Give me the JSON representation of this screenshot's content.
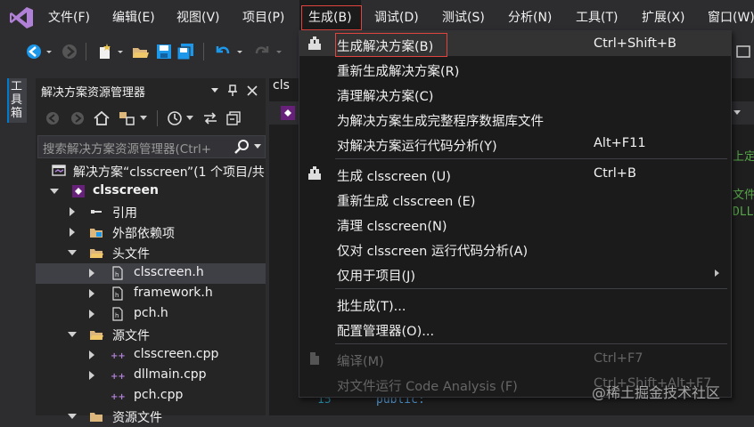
{
  "menubar": {
    "items": [
      {
        "label": "文件(F)"
      },
      {
        "label": "编辑(E)"
      },
      {
        "label": "视图(V)"
      },
      {
        "label": "项目(P)"
      },
      {
        "label": "生成(B)"
      },
      {
        "label": "调试(D)"
      },
      {
        "label": "测试(S)"
      },
      {
        "label": "分析(N)"
      },
      {
        "label": "工具(T)"
      },
      {
        "label": "扩展(X)"
      },
      {
        "label": "窗口(W)"
      }
    ]
  },
  "toolbox": {
    "label": "工具箱"
  },
  "solution_explorer": {
    "title": "解决方案资源管理器",
    "search_placeholder": "搜索解决方案资源管理器(Ctrl+",
    "tree": [
      {
        "label": "解决方案“clsscreen”(1 个项目/共",
        "icon": "solution-icon"
      },
      {
        "label": "clsscreen",
        "icon": "project-icon"
      },
      {
        "label": "引用",
        "icon": "references-icon"
      },
      {
        "label": "外部依赖项",
        "icon": "external-deps-icon"
      },
      {
        "label": "头文件",
        "icon": "folder-icon"
      },
      {
        "label": "clsscreen.h",
        "icon": "header-file-icon"
      },
      {
        "label": "framework.h",
        "icon": "header-file-icon"
      },
      {
        "label": "pch.h",
        "icon": "header-file-icon"
      },
      {
        "label": "源文件",
        "icon": "folder-icon"
      },
      {
        "label": "clsscreen.cpp",
        "icon": "cpp-file-icon"
      },
      {
        "label": "dllmain.cpp",
        "icon": "cpp-file-icon"
      },
      {
        "label": "pch.cpp",
        "icon": "cpp-file-icon"
      },
      {
        "label": "资源文件",
        "icon": "folder-icon"
      }
    ]
  },
  "editor": {
    "tab_label": "cls",
    "line_number": "15",
    "code_line": "public:",
    "side_text": [
      "上定",
      "文件",
      "DLL"
    ]
  },
  "build_menu": {
    "items": [
      {
        "label": "生成解决方案(B)",
        "shortcut": "Ctrl+Shift+B",
        "icon": "build-solution-icon"
      },
      {
        "label": "重新生成解决方案(R)",
        "shortcut": ""
      },
      {
        "label": "清理解决方案(C)",
        "shortcut": ""
      },
      {
        "label": "为解决方案生成完整程序数据库文件",
        "shortcut": ""
      },
      {
        "label": "对解决方案运行代码分析(Y)",
        "shortcut": "Alt+F11"
      },
      {
        "label": "生成 clsscreen (U)",
        "shortcut": "Ctrl+B",
        "icon": "build-project-icon"
      },
      {
        "label": "重新生成 clsscreen (E)",
        "shortcut": ""
      },
      {
        "label": "清理 clsscreen(N)",
        "shortcut": ""
      },
      {
        "label": "仅对 clsscreen 运行代码分析(A)",
        "shortcut": ""
      },
      {
        "label": "仅用于项目(J)",
        "shortcut": "",
        "submenu": true
      },
      {
        "label": "批生成(T)...",
        "shortcut": ""
      },
      {
        "label": "配置管理器(O)...",
        "shortcut": ""
      },
      {
        "label": "编译(M)",
        "shortcut": "Ctrl+F7",
        "disabled": true,
        "icon": "compile-icon"
      },
      {
        "label": "对文件运行 Code Analysis (F)",
        "shortcut": "Ctrl+Shift+Alt+F7",
        "disabled": true
      }
    ]
  },
  "watermark": "@稀土掘金技术社区",
  "colors": {
    "accent": "#007acc",
    "highlight_box": "#e0443e",
    "background": "#2d2d30",
    "menu_bg": "#1b1b1c"
  }
}
